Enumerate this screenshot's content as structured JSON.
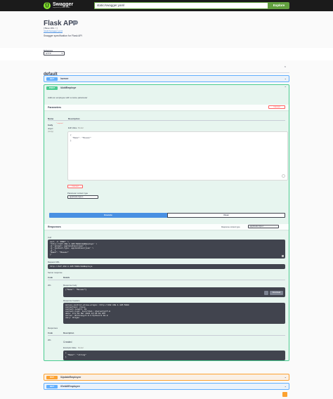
{
  "topbar": {
    "logo_text": "Swagger",
    "logo_sub": "supported by SMARTBEAR",
    "url_value": "static/swagger.yaml",
    "explore_label": "Explore"
  },
  "info": {
    "title": "Flask API",
    "version": "1.0",
    "base_url": "[ Base URL: / ]",
    "spec_link": "/static/swagger.yaml",
    "description": "Swagger specification for Flask API"
  },
  "schemes": {
    "label": "Schemes",
    "value": "HTTP"
  },
  "tag": {
    "name": "default"
  },
  "operations": [
    {
      "method": "GET",
      "path": "/server"
    },
    {
      "method": "POST",
      "path": "/AddEmploye"
    },
    {
      "method": "PUT",
      "path": "/UpdateEmployee"
    },
    {
      "method": "GET",
      "path": "/GetAllEmployee"
    }
  ],
  "post_op": {
    "description": "Adds an employee with a name parameter",
    "parameters_label": "Parameters",
    "cancel_label": "Cancel",
    "col_name": "Name",
    "col_description": "Description",
    "param_name": "body",
    "required_mark": "* required",
    "param_type": "object",
    "param_in": "(body)",
    "edit_value_tab": "Edit Value",
    "model_tab": "Model",
    "body_line1": "{",
    "body_line2": "\"Name\": \"Mosaic\"",
    "body_line3": "}",
    "cancel2_label": "Cancel",
    "content_type_label": "Parameter content type",
    "content_type_value": "application/json",
    "execute_label": "Execute",
    "clear_label": "Clear",
    "responses_label": "Responses",
    "response_ct_label": "Response content type",
    "response_ct_value": "application/json",
    "curl_label": "Curl",
    "curl_lines": [
      "curl -X 'POST' \\",
      "  'http://127.168.1.105:5000/AddEmploye' \\",
      "  -H 'accept: application/json' \\",
      "  -H 'Content-Type: application/json' \\",
      "  -d '{",
      "  \"Name\": \"Mosaic\"",
      "}'"
    ],
    "request_url_label": "Request URL",
    "request_url": "http://127.168.1.105:5000/AddEmploye",
    "server_response_label": "Server response",
    "code_label": "Code",
    "details_label": "Details",
    "code_value": "201",
    "response_body_label": "Response body",
    "response_body": "{\"Name\": \"Mosaic\"}",
    "download_label": "Download",
    "response_headers_label": "Response headers",
    "header_lines": [
      "access-control-allow-origin: http://192.168.1.105:5000",
      "connection: close",
      "content-length: 19",
      "content-type: text/html; charset=utf-8",
      "date: Fri,18 Mar 2022 14:35:18 GMT",
      "server: Werkzeug/2.0.3 Python/3.10.0",
      "vary: Origin"
    ],
    "responses2_label": "Responses",
    "code2_label": "Code",
    "description2_label": "Description",
    "code2_value": "201",
    "created_label": "Created",
    "example_value_tab": "Example Value",
    "model2_tab": "Model",
    "example_line1": "{",
    "example_line2": "\"Name\": \"string\"",
    "example_line3": "}"
  },
  "colors": {
    "get": "#61affe",
    "post": "#49cc90",
    "put": "#fca130",
    "explore": "#62a03f",
    "execute": "#4990e2"
  }
}
